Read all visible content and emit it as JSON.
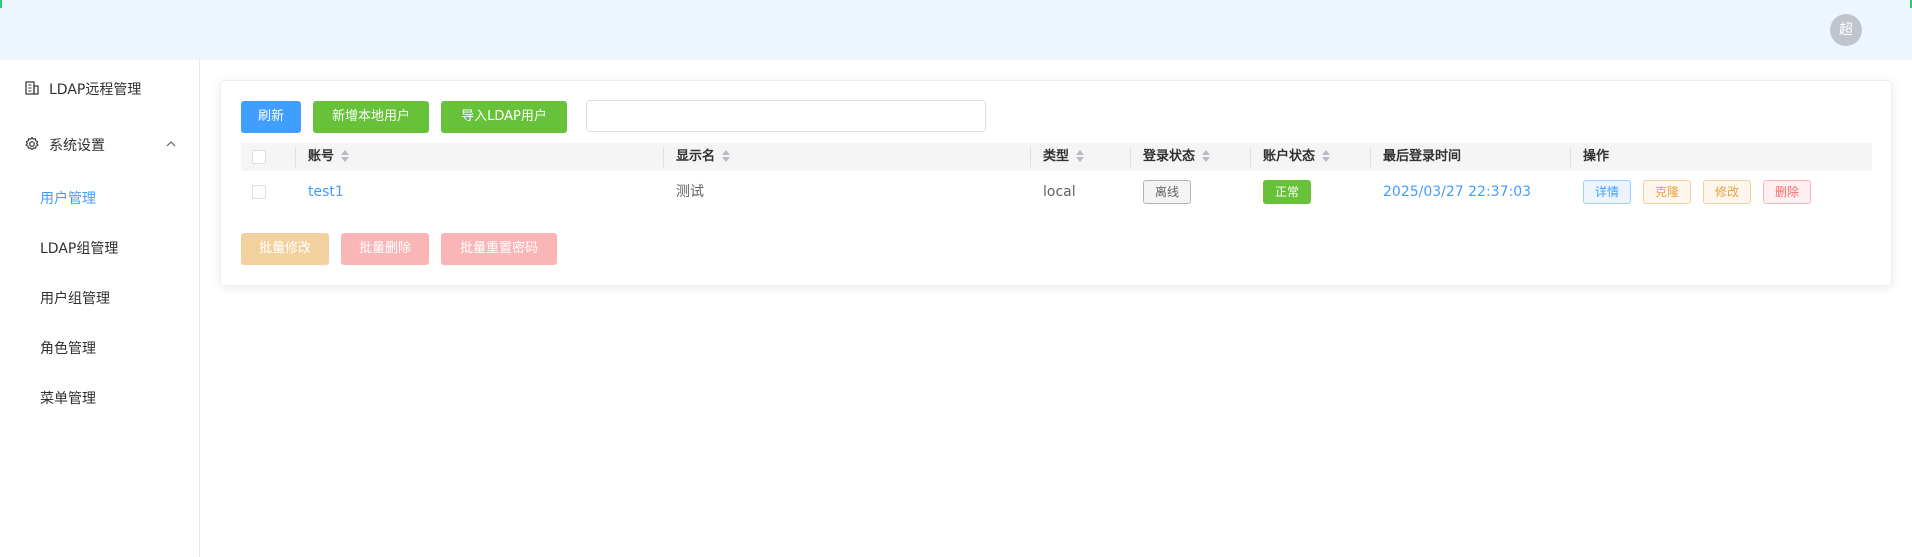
{
  "header": {
    "avatar_text": "超"
  },
  "sidebar": {
    "ldap_remote": "LDAP远程管理",
    "system_settings": "系统设置",
    "items": [
      {
        "label": "用户管理",
        "active": true
      },
      {
        "label": "LDAP组管理"
      },
      {
        "label": "用户组管理"
      },
      {
        "label": "角色管理"
      },
      {
        "label": "菜单管理"
      }
    ]
  },
  "toolbar": {
    "refresh": "刷新",
    "add_local_user": "新增本地用户",
    "import_ldap_user": "导入LDAP用户",
    "search_value": ""
  },
  "table": {
    "columns": [
      "账号",
      "显示名",
      "类型",
      "登录状态",
      "账户状态",
      "最后登录时间",
      "操作"
    ],
    "rows": [
      {
        "account": "test1",
        "display_name": "测试",
        "type": "local",
        "login_status": "离线",
        "account_status": "正常",
        "last_login": "2025/03/27 22:37:03",
        "actions": [
          "详情",
          "克隆",
          "修改",
          "删除"
        ]
      }
    ]
  },
  "bulk": {
    "batch_edit": "批量修改",
    "batch_delete": "批量删除",
    "batch_reset_password": "批量重置密码"
  },
  "colors": {
    "primary": "#409eff",
    "success": "#67c23a",
    "warning": "#e6a23c",
    "danger": "#f56c6c",
    "header_bg": "#eef6fd"
  }
}
